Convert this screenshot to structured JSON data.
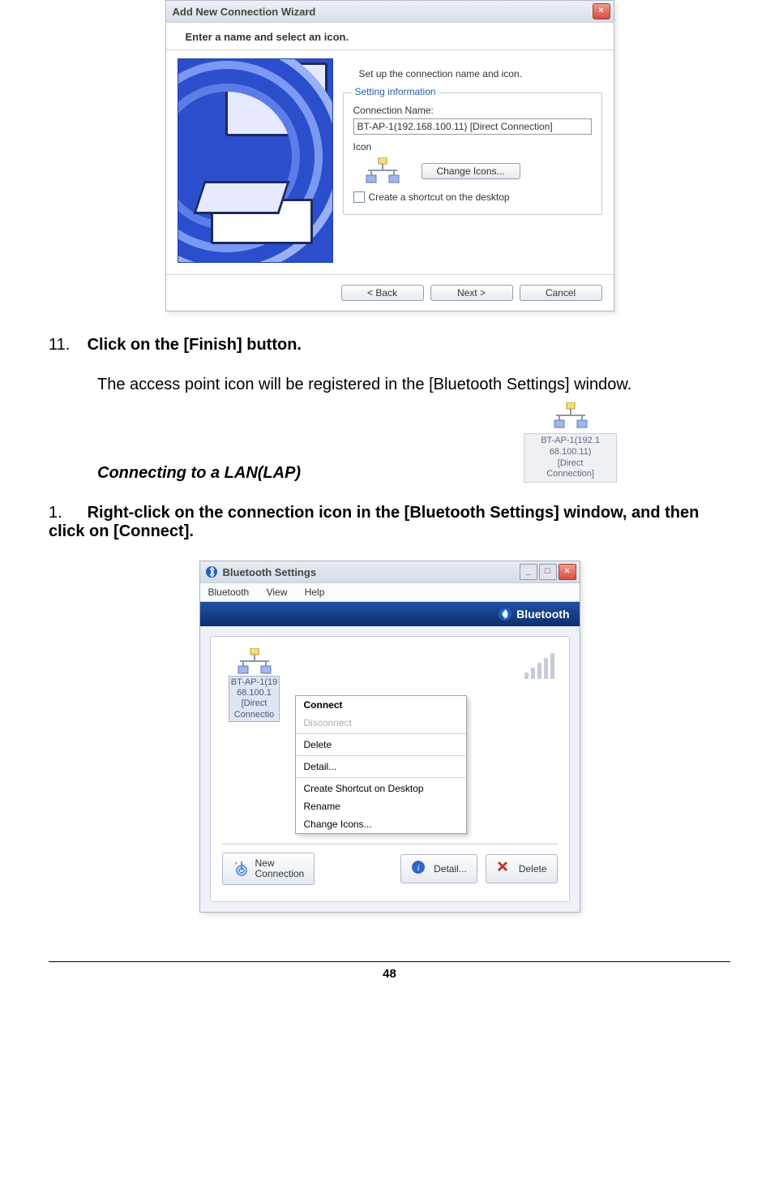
{
  "wizard": {
    "title": "Add New Connection Wizard",
    "subhead": "Enter a name and select an icon.",
    "subtext": "Set up the connection name and icon.",
    "fieldset_legend": "Setting information",
    "conn_label": "Connection Name:",
    "conn_value": "BT-AP-1(192.168.100.11) [Direct Connection]",
    "icon_label": "Icon",
    "change_icons": "Change Icons...",
    "shortcut": "Create a shortcut on the desktop",
    "back": "< Back",
    "next": "Next >",
    "cancel": "Cancel"
  },
  "doc": {
    "step11_num": "11.",
    "step11_txt": "Click on the [Finish] button.",
    "step11_desc": "The access point icon will be registered in the [Bluetooth Settings] window.",
    "icon_label_lines": "BT-AP-1(192.1\n68.100.11)\n[Direct\nConnection]",
    "italic_sub": "Connecting to a LAN(LAP)",
    "step1_num": "1.",
    "step1_txt": "Right-click on the connection icon in the [Bluetooth Settings] window, and then click on [Connect].",
    "page_number": "48"
  },
  "btwin": {
    "title": "Bluetooth Settings",
    "menu": {
      "m1": "Bluetooth",
      "m2": "View",
      "m3": "Help"
    },
    "brand": "Bluetooth",
    "conn_label": "BT-AP-1(19\n68.100.1\n[Direct\nConnectio",
    "context": {
      "connect": "Connect",
      "disconnect": "Disconnect",
      "delete": "Delete",
      "detail": "Detail...",
      "shortcut": "Create Shortcut on Desktop",
      "rename": "Rename",
      "change_icons": "Change Icons..."
    },
    "toolbar": {
      "new_conn": "New\nConnection",
      "detail": "Detail...",
      "delete": "Delete"
    }
  }
}
